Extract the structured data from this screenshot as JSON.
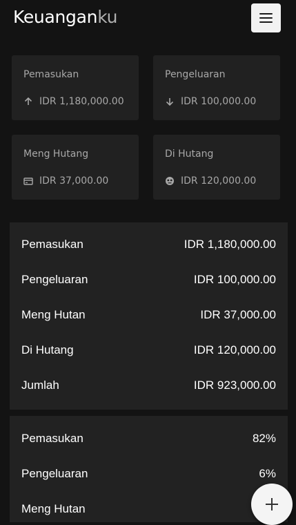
{
  "app": {
    "brand_main": "Keuangan",
    "brand_accent": "ku"
  },
  "cards": [
    {
      "title": "Pemasukan",
      "value": "IDR 1,180,000.00",
      "icon": "arrow-up-icon"
    },
    {
      "title": "Pengeluaran",
      "value": "IDR 100,000.00",
      "icon": "arrow-down-icon"
    },
    {
      "title": "Meng Hutang",
      "value": "IDR 37,000.00",
      "icon": "credit-card-icon"
    },
    {
      "title": "Di Hutang",
      "value": "IDR 120,000.00",
      "icon": "debt-face-icon"
    }
  ],
  "summary": [
    {
      "label": "Pemasukan",
      "value": "IDR 1,180,000.00"
    },
    {
      "label": "Pengeluaran",
      "value": "IDR 100,000.00"
    },
    {
      "label": "Meng Hutan",
      "value": "IDR 37,000.00"
    },
    {
      "label": "Di Hutang",
      "value": "IDR 120,000.00"
    },
    {
      "label": "Jumlah",
      "value": "IDR 923,000.00"
    }
  ],
  "percentages": [
    {
      "label": "Pemasukan",
      "value": "82%"
    },
    {
      "label": "Pengeluaran",
      "value": "6%"
    },
    {
      "label": "Meng Hutan",
      "value": ""
    }
  ],
  "colors": {
    "background": "#131313",
    "card": "#212121",
    "text_muted": "#a8a8a8",
    "button": "#f2f2f2"
  }
}
